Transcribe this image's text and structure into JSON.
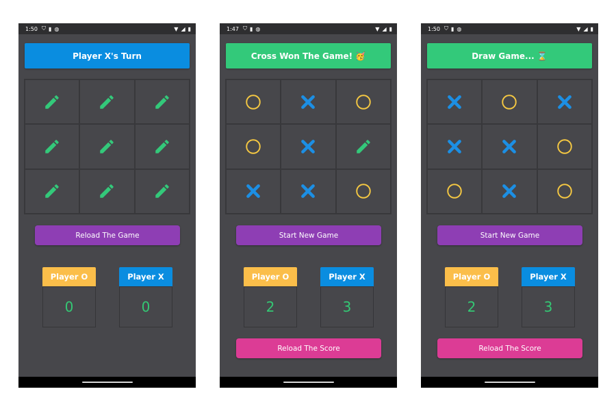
{
  "colors": {
    "background": "#ffffff",
    "phone_bg": "#47474b",
    "status_bar": "#2e2e30",
    "turn_banner": "#0a8de0",
    "result_banner": "#33c97a",
    "pencil": "#33c97a",
    "x_mark": "#1c8fe4",
    "o_mark": "#f5c842",
    "reload_game_button": "#8e3eb4",
    "reload_score_button": "#dc3c95",
    "player_o_label": "#fbbe4a",
    "player_x_label": "#0a8de0",
    "score_value": "#34c874"
  },
  "screens": [
    {
      "status": {
        "time": "1:50"
      },
      "banner": {
        "text": "Player X's Turn",
        "style": "turn"
      },
      "board": [
        "empty",
        "empty",
        "empty",
        "empty",
        "empty",
        "empty",
        "empty",
        "empty",
        "empty"
      ],
      "primary_button": "Reload The Game",
      "scores": {
        "o_label": "Player O",
        "o_value": "0",
        "x_label": "Player X",
        "x_value": "0"
      },
      "secondary_button": ""
    },
    {
      "status": {
        "time": "1:47"
      },
      "banner": {
        "text": "Cross Won The Game! 🥳",
        "style": "result"
      },
      "board": [
        "O",
        "X",
        "O",
        "O",
        "X",
        "empty",
        "X",
        "X",
        "O"
      ],
      "primary_button": "Start New Game",
      "scores": {
        "o_label": "Player O",
        "o_value": "2",
        "x_label": "Player X",
        "x_value": "3"
      },
      "secondary_button": "Reload The Score"
    },
    {
      "status": {
        "time": "1:50"
      },
      "banner": {
        "text": "Draw Game... ⌛",
        "style": "result"
      },
      "board": [
        "X",
        "O",
        "X",
        "X",
        "X",
        "O",
        "O",
        "X",
        "O"
      ],
      "primary_button": "Start New Game",
      "scores": {
        "o_label": "Player O",
        "o_value": "2",
        "x_label": "Player X",
        "x_value": "3"
      },
      "secondary_button": "Reload The Score"
    }
  ]
}
